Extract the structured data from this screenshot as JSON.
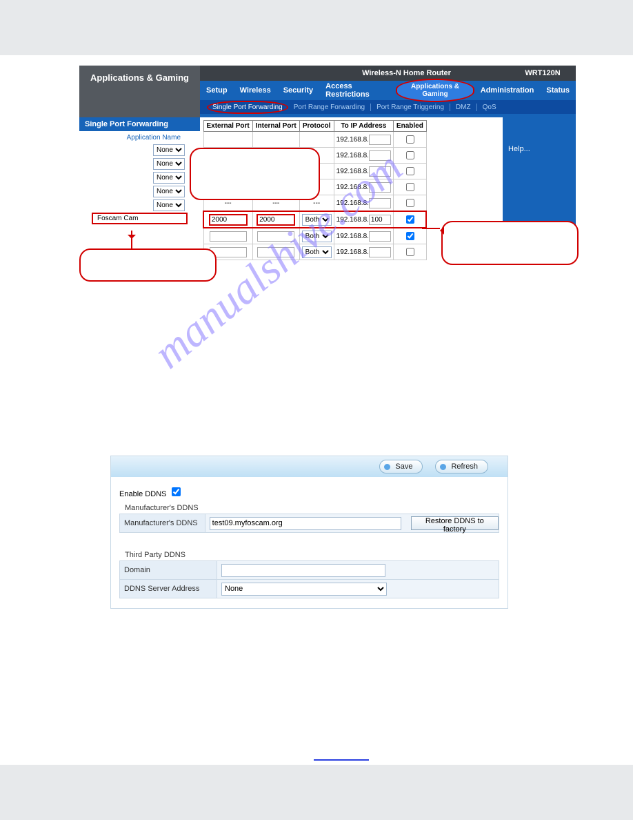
{
  "router": {
    "section": "Applications & Gaming",
    "product": "Wireless-N Home Router",
    "model": "WRT120N",
    "tabs": [
      "Setup",
      "Wireless",
      "Security",
      "Access Restrictions",
      "Applications & Gaming",
      "Administration",
      "Status"
    ],
    "subtabs": [
      "Single Port Forwarding",
      "Port Range Forwarding",
      "Port Range Triggering",
      "DMZ",
      "QoS"
    ],
    "tableTitle": "Single Port Forwarding",
    "appNameLabel": "Application Name",
    "noneOption": "None",
    "headers": {
      "ext": "External Port",
      "int": "Internal Port",
      "proto": "Protocol",
      "ip": "To IP Address",
      "en": "Enabled"
    },
    "ipPrefix": "192.168.8.",
    "dashes": "---",
    "foscamLabel": "Foscam Cam",
    "port": "2000",
    "ipSuffix": "100",
    "protoOption": "Both",
    "help": "Help..."
  },
  "watermark": "manualshive.com",
  "ddns": {
    "save": "Save",
    "refresh": "Refresh",
    "enable": "Enable DDNS",
    "manuSection": "Manufacturer's DDNS",
    "manuLabel": "Manufacturer's DDNS",
    "manuVal": "test09.myfoscam.org",
    "restore": "Restore DDNS to factory",
    "thirdSection": "Third Party DDNS",
    "domainLabel": "Domain",
    "serverLabel": "DDNS Server Address",
    "noneOption": "None"
  }
}
